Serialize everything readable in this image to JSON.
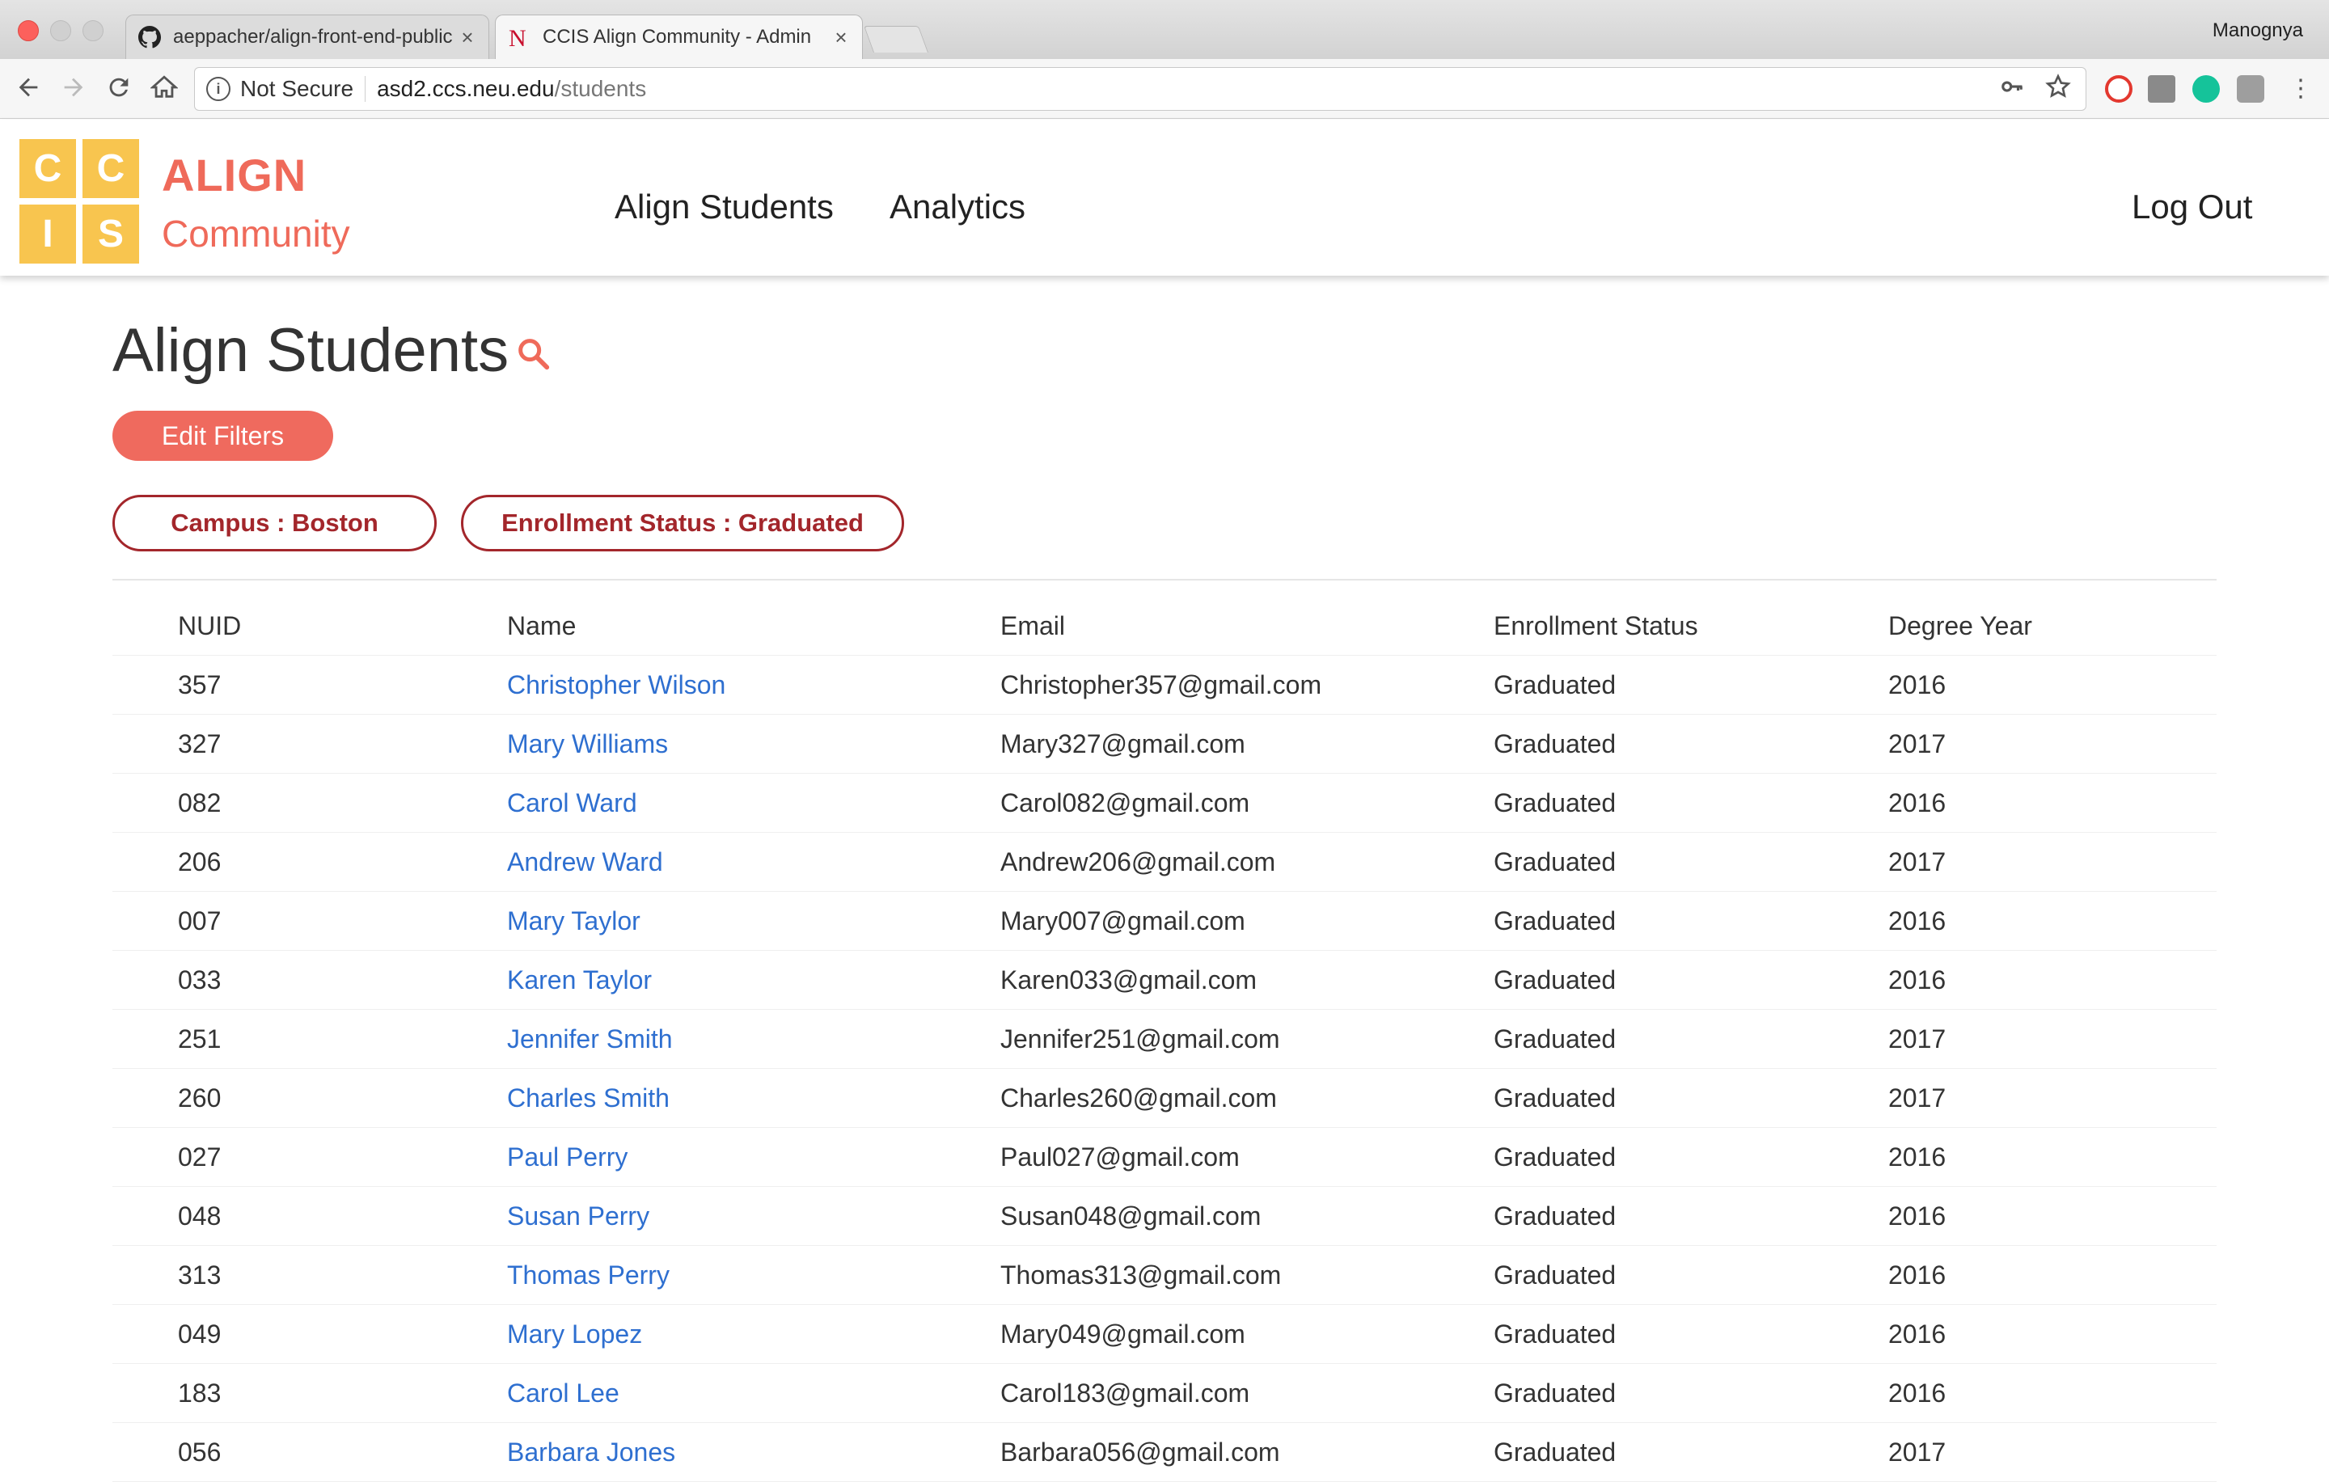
{
  "browser": {
    "tabs": [
      {
        "title": "aeppacher/align-front-end-public",
        "favicon": "github-icon"
      },
      {
        "title": "CCIS Align Community - Admin",
        "favicon": "neu-n-icon"
      }
    ],
    "profile": "Manognya",
    "security_label": "Not Secure",
    "url_host": "asd2.ccs.neu.edu",
    "url_path": "/students"
  },
  "app": {
    "logo_letters": [
      "C",
      "C",
      "I",
      "S"
    ],
    "logo_title": "ALIGN",
    "logo_subtitle": "Community",
    "logo_color": "#f8c54f",
    "brand_color": "#ef6a5a",
    "nav": [
      {
        "label": "Align Students"
      },
      {
        "label": "Analytics"
      }
    ],
    "logout_label": "Log Out"
  },
  "main": {
    "title": "Align Students",
    "edit_filters_label": "Edit Filters",
    "filters": [
      {
        "label": "Campus : Boston"
      },
      {
        "label": "Enrollment Status : Graduated"
      }
    ],
    "filter_color": "#a3262b",
    "link_color": "#2e6fd0"
  },
  "table": {
    "columns": [
      "NUID",
      "Name",
      "Email",
      "Enrollment Status",
      "Degree Year"
    ],
    "rows": [
      {
        "nuid": "357",
        "name": "Christopher Wilson",
        "email": "Christopher357@gmail.com",
        "status": "Graduated",
        "year": "2016"
      },
      {
        "nuid": "327",
        "name": "Mary Williams",
        "email": "Mary327@gmail.com",
        "status": "Graduated",
        "year": "2017"
      },
      {
        "nuid": "082",
        "name": "Carol Ward",
        "email": "Carol082@gmail.com",
        "status": "Graduated",
        "year": "2016"
      },
      {
        "nuid": "206",
        "name": "Andrew Ward",
        "email": "Andrew206@gmail.com",
        "status": "Graduated",
        "year": "2017"
      },
      {
        "nuid": "007",
        "name": "Mary Taylor",
        "email": "Mary007@gmail.com",
        "status": "Graduated",
        "year": "2016"
      },
      {
        "nuid": "033",
        "name": "Karen Taylor",
        "email": "Karen033@gmail.com",
        "status": "Graduated",
        "year": "2016"
      },
      {
        "nuid": "251",
        "name": "Jennifer Smith",
        "email": "Jennifer251@gmail.com",
        "status": "Graduated",
        "year": "2017"
      },
      {
        "nuid": "260",
        "name": "Charles Smith",
        "email": "Charles260@gmail.com",
        "status": "Graduated",
        "year": "2017"
      },
      {
        "nuid": "027",
        "name": "Paul Perry",
        "email": "Paul027@gmail.com",
        "status": "Graduated",
        "year": "2016"
      },
      {
        "nuid": "048",
        "name": "Susan Perry",
        "email": "Susan048@gmail.com",
        "status": "Graduated",
        "year": "2016"
      },
      {
        "nuid": "313",
        "name": "Thomas Perry",
        "email": "Thomas313@gmail.com",
        "status": "Graduated",
        "year": "2016"
      },
      {
        "nuid": "049",
        "name": "Mary Lopez",
        "email": "Mary049@gmail.com",
        "status": "Graduated",
        "year": "2016"
      },
      {
        "nuid": "183",
        "name": "Carol Lee",
        "email": "Carol183@gmail.com",
        "status": "Graduated",
        "year": "2016"
      },
      {
        "nuid": "056",
        "name": "Barbara Jones",
        "email": "Barbara056@gmail.com",
        "status": "Graduated",
        "year": "2017"
      }
    ]
  }
}
